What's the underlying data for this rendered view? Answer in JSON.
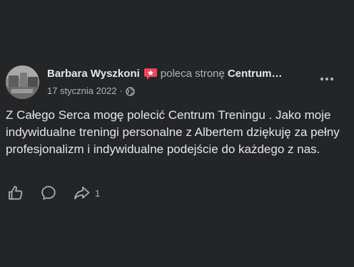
{
  "post": {
    "author": "Barbara Wyszkoni",
    "verb": "poleca stronę",
    "page_name": "Centrum…",
    "date": "17 stycznia 2022",
    "separator": "·",
    "privacy_icon": "globe-icon",
    "recommend_badge_icon": "speech-bubble-star-icon",
    "recommend_badge_color": "#f3425f",
    "text": "Z Całego Serca mogę polecić Centrum Treningu . Jako moje indywidualne treningi personalne z Albertem dziękuję za pełny profesjonalizm i indywidualne podejście do każdego z nas.",
    "more_icon": "ellipsis-icon"
  },
  "actions": {
    "like_icon": "thumbs-up-icon",
    "comment_icon": "comment-bubble-icon",
    "share_icon": "share-arrow-icon",
    "share_count": "1"
  },
  "colors": {
    "background": "#242526",
    "primary_text": "#e4e6eb",
    "secondary_text": "#b0b3b8"
  }
}
